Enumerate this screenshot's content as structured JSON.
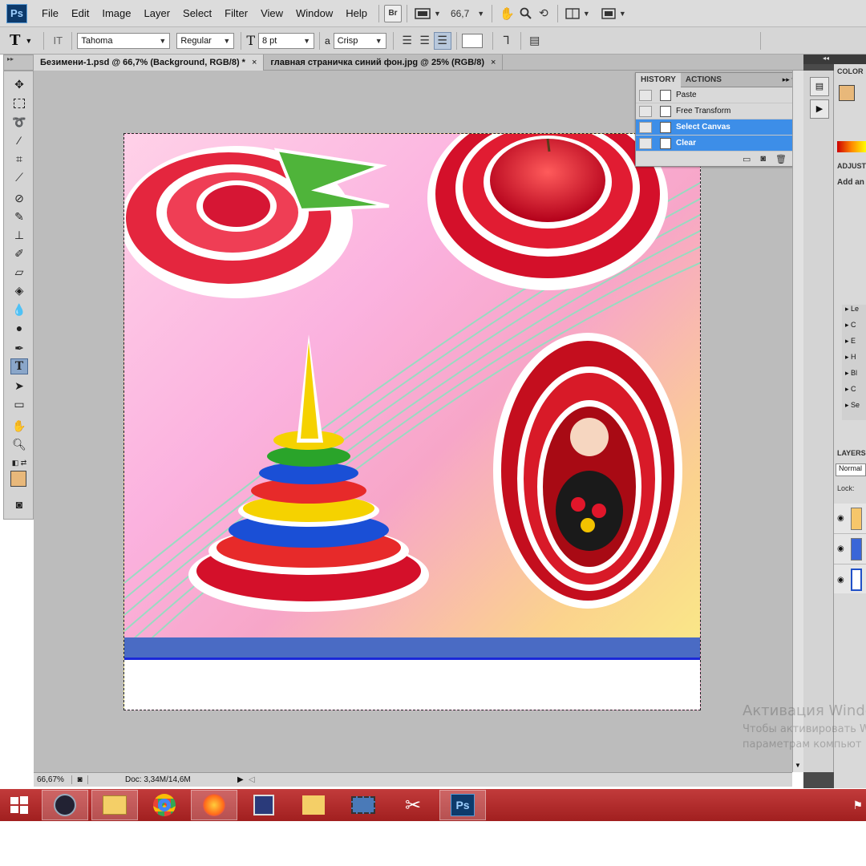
{
  "app": {
    "logo": "Ps"
  },
  "menu": [
    "File",
    "Edit",
    "Image",
    "Layer",
    "Select",
    "Filter",
    "View",
    "Window",
    "Help"
  ],
  "menubar": {
    "bridge_label": "Br",
    "zoom_value": "66,7"
  },
  "options": {
    "tool_glyph": "T",
    "font_family": "Tahoma",
    "font_style": "Regular",
    "font_size": "8 pt",
    "aa_label": "a",
    "antialias": "Crisp"
  },
  "tabs": [
    {
      "label": "Безимени-1.psd @ 66,7% (Background, RGB/8) *",
      "close": "×",
      "active": true
    },
    {
      "label": "главная страничка синий фон.jpg @ 25% (RGB/8)",
      "close": "×",
      "active": false
    }
  ],
  "history": {
    "tabs": [
      "HISTORY",
      "ACTIONS"
    ],
    "items": [
      "Paste",
      "Free Transform",
      "Select Canvas",
      "Clear"
    ],
    "selected_from": 2
  },
  "right_panels": {
    "color_title": "COLOR",
    "adjust_title": "ADJUST",
    "adjust_subtitle": "Add an",
    "layers_title": "LAYERS",
    "blend_mode": "Normal",
    "lock_label": "Lock:",
    "adjust_list": [
      "Le",
      "C",
      "E",
      "H",
      "Bl",
      "C",
      "Se"
    ]
  },
  "status": {
    "zoom": "66,67%",
    "doc": "Doc: 3,34M/14,6M"
  },
  "activation": {
    "title": "Активация Windo",
    "line1": "Чтобы активировать W",
    "line2": "параметрам компьют"
  },
  "colors": {
    "foreground": "#e8b87a",
    "background": "#ffffff",
    "highlight": "#3d8ee8",
    "taskbar": "#b12a2a"
  }
}
